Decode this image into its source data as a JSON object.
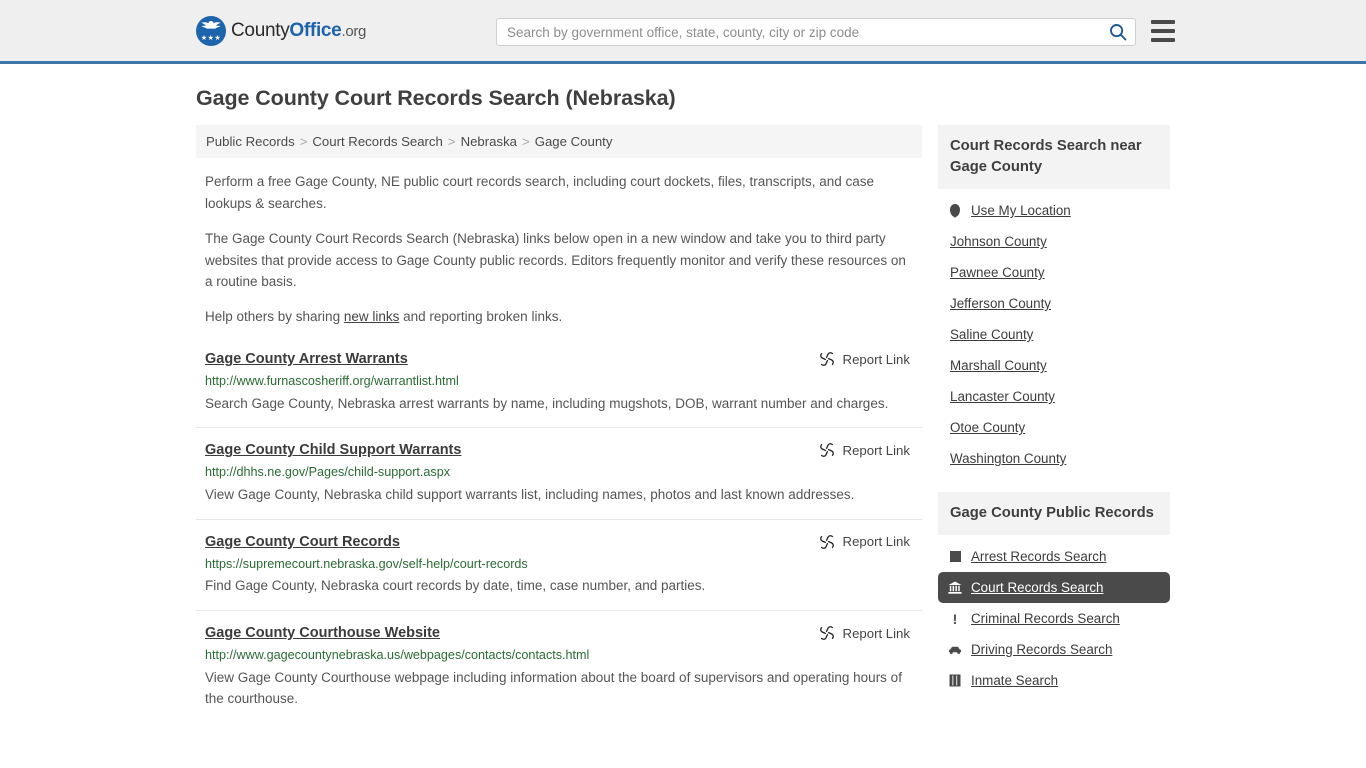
{
  "header": {
    "logo": {
      "part1": "County",
      "part2": "Office",
      "part3": ".org",
      "icon": "eagle-shield-icon",
      "stars": "★★★"
    },
    "search": {
      "placeholder": "Search by government office, state, county, city or zip code",
      "value": "",
      "icon": "search-icon"
    },
    "menu_icon": "hamburger-menu-icon",
    "accent_color": "#3b75ab"
  },
  "page": {
    "title": "Gage County Court Records Search (Nebraska)"
  },
  "breadcrumb": {
    "separator": ">",
    "items": [
      {
        "label": "Public Records"
      },
      {
        "label": "Court Records Search"
      },
      {
        "label": "Nebraska"
      },
      {
        "label": "Gage County"
      }
    ]
  },
  "intro": {
    "p1": "Perform a free Gage County, NE public court records search, including court dockets, files, transcripts, and case lookups & searches.",
    "p2": "The Gage County Court Records Search (Nebraska) links below open in a new window and take you to third party websites that provide access to Gage County public records. Editors frequently monitor and verify these resources on a routine basis.",
    "p3_before": "Help others by sharing ",
    "p3_link": "new links",
    "p3_after": " and reporting broken links."
  },
  "results": {
    "report_label": "Report Link",
    "report_icon": "broken-link-icon",
    "items": [
      {
        "title": "Gage County Arrest Warrants",
        "url": "http://www.furnascosheriff.org/warrantlist.html",
        "description": "Search Gage County, Nebraska arrest warrants by name, including mugshots, DOB, warrant number and charges."
      },
      {
        "title": "Gage County Child Support Warrants",
        "url": "http://dhhs.ne.gov/Pages/child-support.aspx",
        "description": "View Gage County, Nebraska child support warrants list, including names, photos and last known addresses."
      },
      {
        "title": "Gage County Court Records",
        "url": "https://supremecourt.nebraska.gov/self-help/court-records",
        "description": "Find Gage County, Nebraska court records by date, time, case number, and parties."
      },
      {
        "title": "Gage County Courthouse Website",
        "url": "http://www.gagecountynebraska.us/webpages/contacts/contacts.html",
        "description": "View Gage County Courthouse webpage including information about the board of supervisors and operating hours of the courthouse."
      }
    ]
  },
  "sidebar": {
    "nearby": {
      "heading": "Court Records Search near Gage County",
      "items": [
        {
          "label": "Use My Location",
          "icon": "map-pin-icon"
        },
        {
          "label": "Johnson County",
          "icon": ""
        },
        {
          "label": "Pawnee County",
          "icon": ""
        },
        {
          "label": "Jefferson County",
          "icon": ""
        },
        {
          "label": "Saline County",
          "icon": ""
        },
        {
          "label": "Marshall County",
          "icon": ""
        },
        {
          "label": "Lancaster County",
          "icon": ""
        },
        {
          "label": "Otoe County",
          "icon": ""
        },
        {
          "label": "Washington County",
          "icon": ""
        }
      ]
    },
    "public_records": {
      "heading": "Gage County Public Records",
      "items": [
        {
          "label": "Arrest Records Search",
          "icon": "fingerprint-square-icon",
          "active": false
        },
        {
          "label": "Court Records Search",
          "icon": "courthouse-icon",
          "active": true
        },
        {
          "label": "Criminal Records Search",
          "icon": "exclamation-icon",
          "active": false
        },
        {
          "label": "Driving Records Search",
          "icon": "car-icon",
          "active": false
        },
        {
          "label": "Inmate Search",
          "icon": "jail-icon",
          "active": false
        }
      ]
    }
  }
}
